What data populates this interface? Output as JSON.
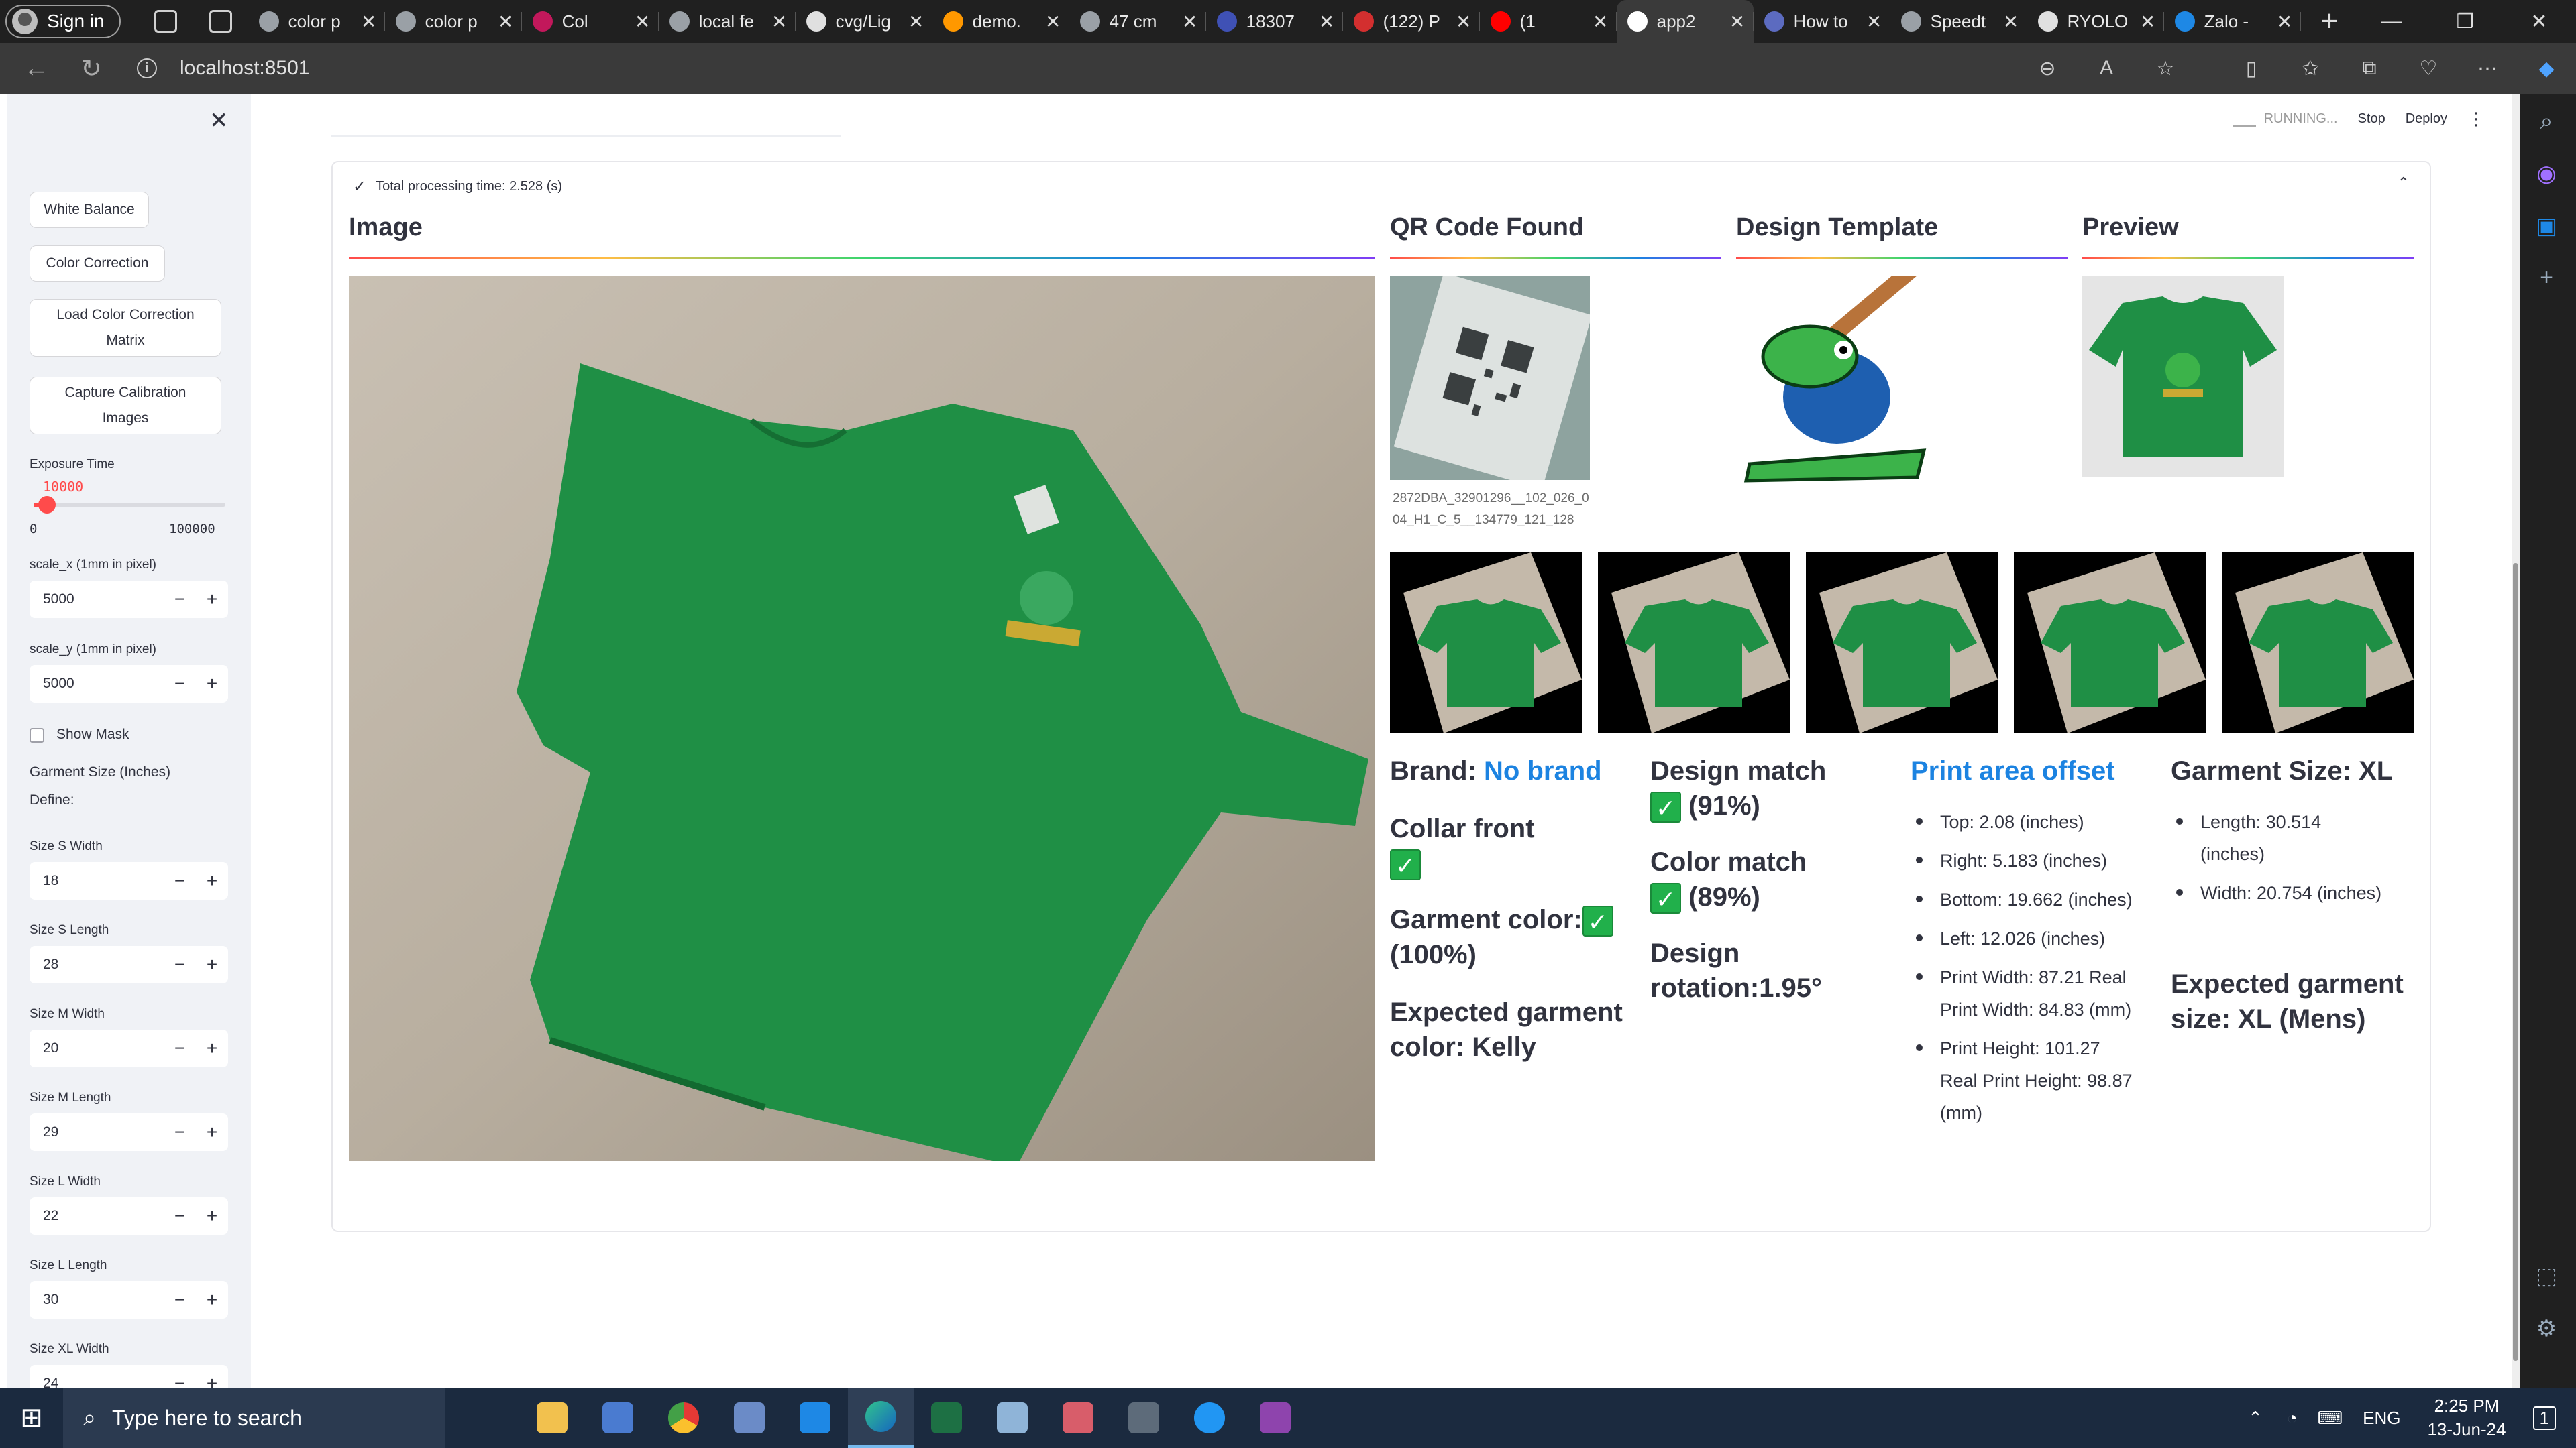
{
  "browser": {
    "signin": "Sign in",
    "tabs": [
      {
        "title": "color p",
        "color": "#9aa0a6"
      },
      {
        "title": "color p",
        "color": "#9aa0a6"
      },
      {
        "title": "Col",
        "color": "#c2185b"
      },
      {
        "title": "local fe",
        "color": "#9aa0a6"
      },
      {
        "title": "cvg/Lig",
        "color": "#e0e0e0"
      },
      {
        "title": "demo.",
        "color": "#ff9800"
      },
      {
        "title": "47 cm",
        "color": "#9aa0a6"
      },
      {
        "title": "18307",
        "color": "#3f51b5"
      },
      {
        "title": "(122) P",
        "color": "#d32f2f"
      },
      {
        "title": "(1",
        "color": "#ff0000"
      },
      {
        "title": "app2",
        "color": "#ffffff"
      },
      {
        "title": "How to",
        "color": "#5c6bc0"
      },
      {
        "title": "Speedt",
        "color": "#9aa0a6"
      },
      {
        "title": "RYOLO",
        "color": "#e0e0e0"
      },
      {
        "title": "Zalo -",
        "color": "#1e88e5"
      }
    ],
    "url": "localhost:8501"
  },
  "sidebar": {
    "buttons": [
      "White Balance",
      "Color Correction",
      "Load Color Correction Matrix",
      "Capture Calibration Images"
    ],
    "exposure_label": "Exposure Time",
    "exposure_value": "10000",
    "exposure_fraction": 0.1,
    "exposure_min": "0",
    "exposure_max": "100000",
    "scale_x_label": "scale_x (1mm in pixel)",
    "scale_x": "5000",
    "scale_y_label": "scale_y (1mm in pixel)",
    "scale_y": "5000",
    "show_mask": "Show Mask",
    "garment_size_title": "Garment Size (Inches)",
    "define": "Define:",
    "sizes": [
      {
        "label": "Size S Width",
        "value": "18"
      },
      {
        "label": "Size S Length",
        "value": "28"
      },
      {
        "label": "Size M Width",
        "value": "20"
      },
      {
        "label": "Size M Length",
        "value": "29"
      },
      {
        "label": "Size L Width",
        "value": "22"
      },
      {
        "label": "Size L Length",
        "value": "30"
      },
      {
        "label": "Size XL Width",
        "value": "24"
      }
    ]
  },
  "header": {
    "running": "RUNNING...",
    "stop": "Stop",
    "deploy": "Deploy"
  },
  "expander": {
    "title": "Total processing time: 2.528 (s)"
  },
  "sections": {
    "image": "Image",
    "qr": "QR Code Found",
    "template": "Design Template",
    "preview": "Preview"
  },
  "qr_caption": "2872DBA_32901296__102_026_0 04_H1_C_5__134779_121_128",
  "results": {
    "brand_label": "Brand:",
    "brand_value": "No brand",
    "collar": "Collar front",
    "garment_color": "Garment color:",
    "garment_color_pct": "(100%)",
    "expected_color": "Expected garment color: Kelly",
    "design_match": "Design match",
    "design_match_pct": "(91%)",
    "color_match": "Color match",
    "color_match_pct": "(89%)",
    "design_rotation": "Design rotation:1.95°",
    "offset_title": "Print area offset",
    "offset_items": [
      "Top: 2.08 (inches)",
      "Right: 5.183 (inches)",
      "Bottom: 19.662 (inches)",
      "Left: 12.026 (inches)",
      "Print Width: 87.21 Real Print Width: 84.83 (mm)",
      "Print Height: 101.27 Real Print Height: 98.87 (mm)"
    ],
    "size_title": "Garment Size: XL",
    "size_items": [
      "Length: 30.514 (inches)",
      "Width: 20.754 (inches)"
    ],
    "expected_size": "Expected garment size: XL (Mens)"
  },
  "taskbar": {
    "search_placeholder": "Type here to search",
    "lang": "ENG",
    "time": "2:25 PM",
    "date": "13-Jun-24",
    "notifications": "1"
  },
  "colors": {
    "accent": "#ff4b4b",
    "link": "#1c83e1",
    "shirt": "#1c8a43",
    "check": "#21b04b"
  }
}
